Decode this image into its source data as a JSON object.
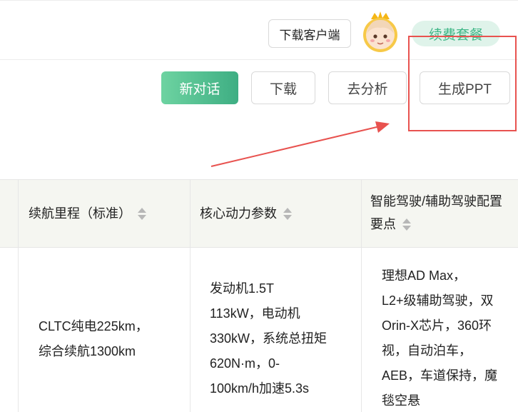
{
  "header": {
    "download_client_label": "下载客户端",
    "renew_label": "续费套餐",
    "avatar_icon": "crowned-avatar-icon"
  },
  "toolbar": {
    "new_chat_label": "新对话",
    "download_label": "下载",
    "analyze_label": "去分析",
    "generate_ppt_label": "生成PPT"
  },
  "annotation": {
    "color": "#e8524f"
  },
  "table": {
    "columns": [
      {
        "label": "续航里程（标准）"
      },
      {
        "label": "核心动力参数"
      },
      {
        "label": "智能驾驶/辅助驾驶配置",
        "label2": "要点"
      }
    ],
    "row": {
      "range_lines": [
        "CLTC纯电225km，",
        "综合续航1300km"
      ],
      "power_lines": [
        "发动机1.5T",
        "113kW，电动机",
        "330kW，系统总扭矩",
        "620N·m，0-",
        "100km/h加速5.3s"
      ],
      "adas_lines": [
        "理想AD Max，",
        "L2+级辅助驾驶，双",
        "Orin-X芯片，360环",
        "视，自动泊车，",
        "AEB，车道保持，魔",
        "毯空悬"
      ]
    }
  },
  "colors": {
    "accent": "#3eae83",
    "renew_bg": "#dff3ea",
    "header_bg": "#f5f6f1"
  }
}
